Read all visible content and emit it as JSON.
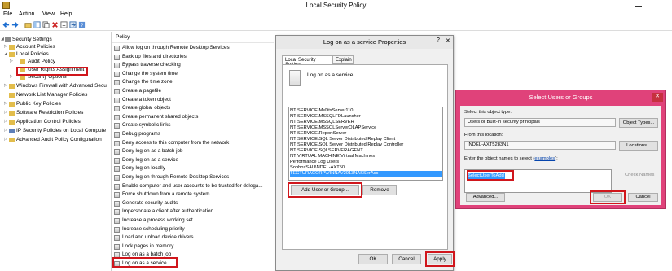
{
  "window": {
    "title": "Local Security Policy"
  },
  "menu": [
    "File",
    "Action",
    "View",
    "Help"
  ],
  "tree": [
    {
      "label": "Security Settings",
      "level": 0,
      "exp": "◢"
    },
    {
      "label": "Account Policies",
      "level": 1,
      "exp": "▷"
    },
    {
      "label": "Local Policies",
      "level": 1,
      "exp": "◢"
    },
    {
      "label": "Audit Policy",
      "level": 2,
      "exp": "▷"
    },
    {
      "label": "User Rights Assignment",
      "level": 2,
      "exp": ""
    },
    {
      "label": "Security Options",
      "level": 2,
      "exp": "▷"
    },
    {
      "label": "Windows Firewall with Advanced Secu",
      "level": 1,
      "exp": "▷"
    },
    {
      "label": "Network List Manager Policies",
      "level": 1,
      "exp": ""
    },
    {
      "label": "Public Key Policies",
      "level": 1,
      "exp": "▷"
    },
    {
      "label": "Software Restriction Policies",
      "level": 1,
      "exp": "▷"
    },
    {
      "label": "Application Control Policies",
      "level": 1,
      "exp": "▷"
    },
    {
      "label": "IP Security Policies on Local Compute",
      "level": 1,
      "exp": "▷"
    },
    {
      "label": "Advanced Audit Policy Configuration",
      "level": 1,
      "exp": "▷"
    }
  ],
  "policy_header": "Policy",
  "policies": [
    "Allow log on through Remote Desktop Services",
    "Back up files and directories",
    "Bypass traverse checking",
    "Change the system time",
    "Change the time zone",
    "Create a pagefile",
    "Create a token object",
    "Create global objects",
    "Create permanent shared objects",
    "Create symbolic links",
    "Debug programs",
    "Deny access to this computer from the network",
    "Deny log on as a batch job",
    "Deny log on as a service",
    "Deny log on locally",
    "Deny log on through Remote Desktop Services",
    "Enable computer and user accounts to be trusted for delega...",
    "Force shutdown from a remote system",
    "Generate security audits",
    "Impersonate a client after authentication",
    "Increase a process working set",
    "Increase scheduling priority",
    "Load and unload device drivers",
    "Lock pages in memory",
    "Log on as a batch job",
    "Log on as a service"
  ],
  "props_dialog": {
    "title": "Log on as a service Properties",
    "help": "?",
    "close": "✕",
    "tabs": [
      "Local Security Setting",
      "Explain"
    ],
    "policy_name": "Log on as a service",
    "accounts": [
      "NT SERVICE\\MsDtsServer110",
      "NT SERVICE\\MSSQLFDLauncher",
      "NT SERVICE\\MSSQLSERVER",
      "NT SERVICE\\MSSQLServerOLAPService",
      "NT SERVICE\\ReportServer",
      "NT SERVICE\\SQL Server Distributed Replay Client",
      "NT SERVICE\\SQL Server Distributed Replay Controller",
      "NT SERVICE\\SQLSERVERAGENT",
      "NT VIRTUAL MACHINE\\Virtual Machines",
      "Performance Log Users",
      "SophosSAU\\NDEL-AXT50",
      "TECTURACORP\\VINNAV2013NASSerAcc"
    ],
    "add_button": "Add User or Group...",
    "remove_button": "Remove",
    "ok_button": "OK",
    "cancel_button": "Cancel",
    "apply_button": "Apply"
  },
  "select_dialog": {
    "title": "Select Users or Groups",
    "close": "✕",
    "object_type_label": "Select this object type:",
    "object_type_value": "Users or Built-in security principals",
    "object_types_button": "Object Types...",
    "location_label": "From this location:",
    "location_value": "INDEL-AXT5283N1",
    "locations_button": "Locations...",
    "names_label_prefix": "Enter the object names to select (",
    "names_label_link": "examples",
    "names_label_suffix": "):",
    "names_value": "SelectUserToAdd",
    "check_names_button": "Check Names",
    "advanced_button": "Advanced...",
    "ok_button": "OK",
    "cancel_button": "Cancel"
  }
}
